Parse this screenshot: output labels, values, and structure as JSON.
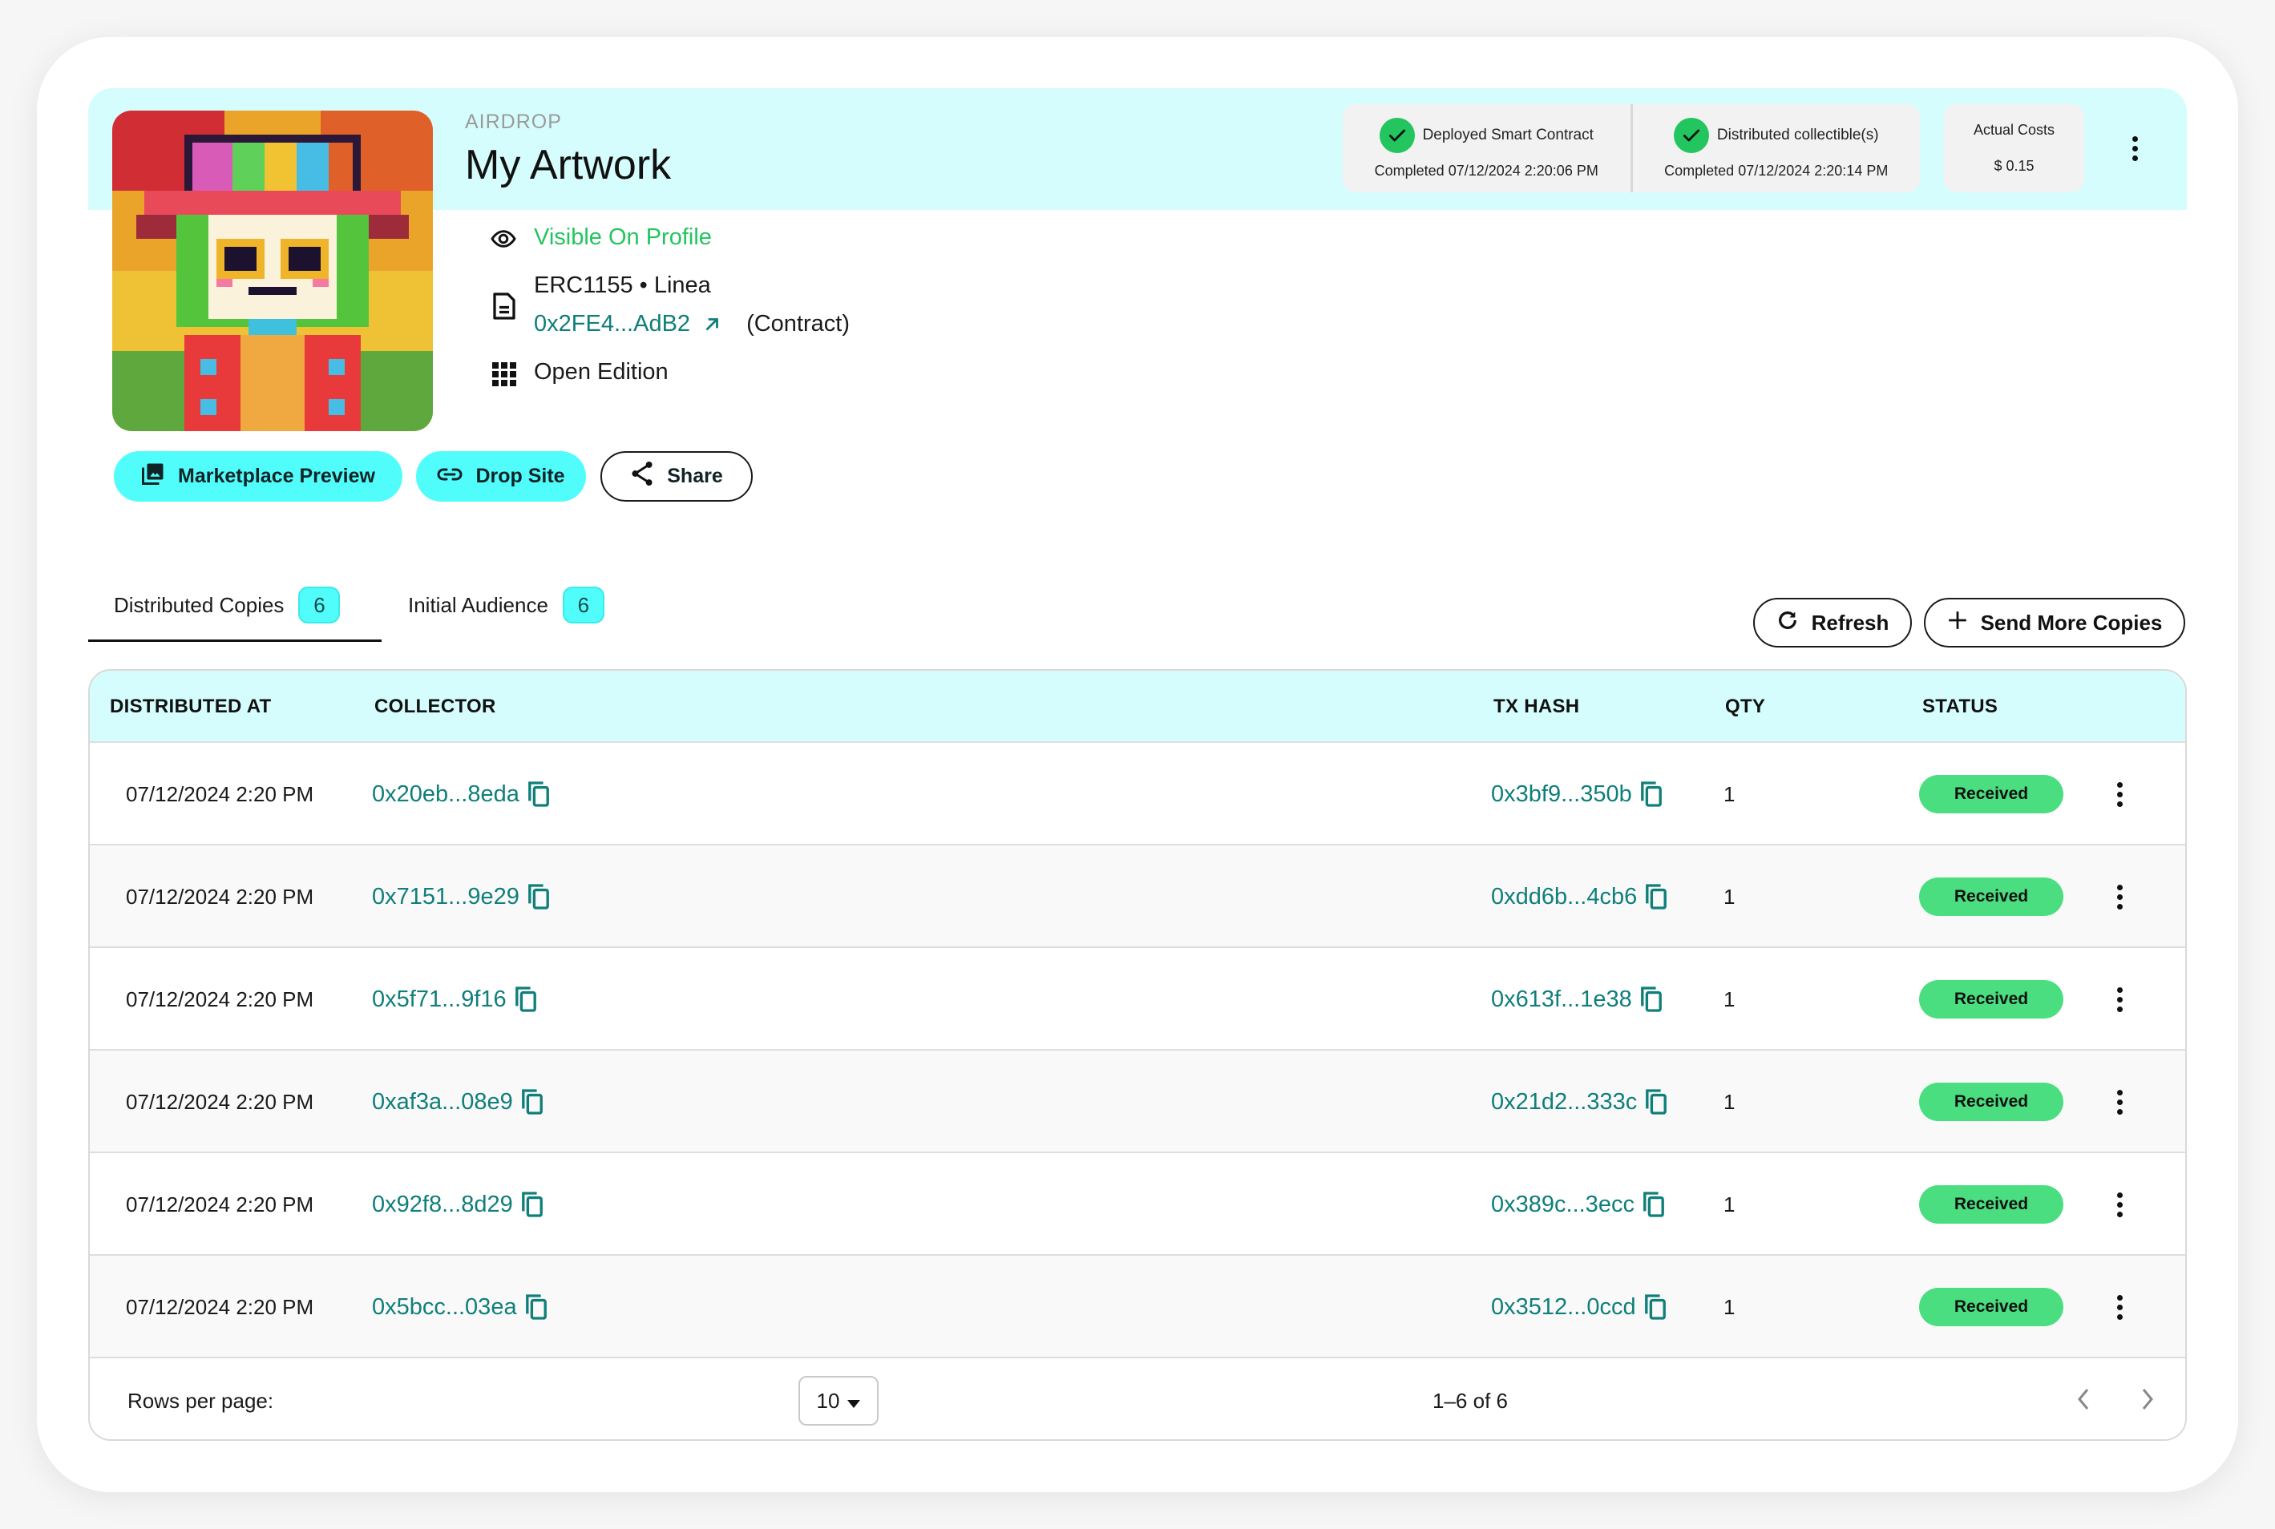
{
  "header": {
    "kicker": "AIRDROP",
    "title": "My Artwork",
    "status_steps": [
      {
        "label": "Deployed Smart Contract",
        "sub": "Completed 07/12/2024 2:20:06 PM",
        "state": "done"
      },
      {
        "label": "Distributed collectible(s)",
        "sub": "Completed 07/12/2024 2:20:14 PM",
        "state": "done"
      }
    ],
    "costs": {
      "label": "Actual Costs",
      "value": "$ 0.15"
    }
  },
  "info": {
    "visibility": "Visible On Profile",
    "standard_chain": "ERC1155 • Linea",
    "contract_address": "0x2FE4...AdB2",
    "contract_suffix": "(Contract)",
    "edition": "Open Edition"
  },
  "actions": {
    "marketplace_preview": "Marketplace Preview",
    "drop_site": "Drop Site",
    "share": "Share",
    "refresh": "Refresh",
    "send_more": "Send More Copies"
  },
  "tabs": [
    {
      "label": "Distributed Copies",
      "count": "6",
      "active": true
    },
    {
      "label": "Initial Audience",
      "count": "6",
      "active": false
    }
  ],
  "table": {
    "columns": {
      "distributed_at": "DISTRIBUTED AT",
      "collector": "COLLECTOR",
      "tx_hash": "TX HASH",
      "qty": "QTY",
      "status": "STATUS"
    },
    "rows": [
      {
        "distributed_at": "07/12/2024 2:20 PM",
        "collector": "0x20eb...8eda",
        "tx_hash": "0x3bf9...350b",
        "qty": "1",
        "status": "Received"
      },
      {
        "distributed_at": "07/12/2024 2:20 PM",
        "collector": "0x7151...9e29",
        "tx_hash": "0xdd6b...4cb6",
        "qty": "1",
        "status": "Received"
      },
      {
        "distributed_at": "07/12/2024 2:20 PM",
        "collector": "0x5f71...9f16",
        "tx_hash": "0x613f...1e38",
        "qty": "1",
        "status": "Received"
      },
      {
        "distributed_at": "07/12/2024 2:20 PM",
        "collector": "0xaf3a...08e9",
        "tx_hash": "0x21d2...333c",
        "qty": "1",
        "status": "Received"
      },
      {
        "distributed_at": "07/12/2024 2:20 PM",
        "collector": "0x92f8...8d29",
        "tx_hash": "0x389c...3ecc",
        "qty": "1",
        "status": "Received"
      },
      {
        "distributed_at": "07/12/2024 2:20 PM",
        "collector": "0x5bcc...03ea",
        "tx_hash": "0x3512...0ccd",
        "qty": "1",
        "status": "Received"
      }
    ],
    "footer": {
      "rows_per_page_label": "Rows per page:",
      "rows_per_page_value": "10",
      "range": "1–6 of 6"
    }
  },
  "colors": {
    "accent_cyan": "#50fdfb",
    "header_bg": "#d6fdfd",
    "link_teal": "#0f7f7a",
    "success_green": "#22c55e",
    "received_pill": "#4ade80"
  }
}
